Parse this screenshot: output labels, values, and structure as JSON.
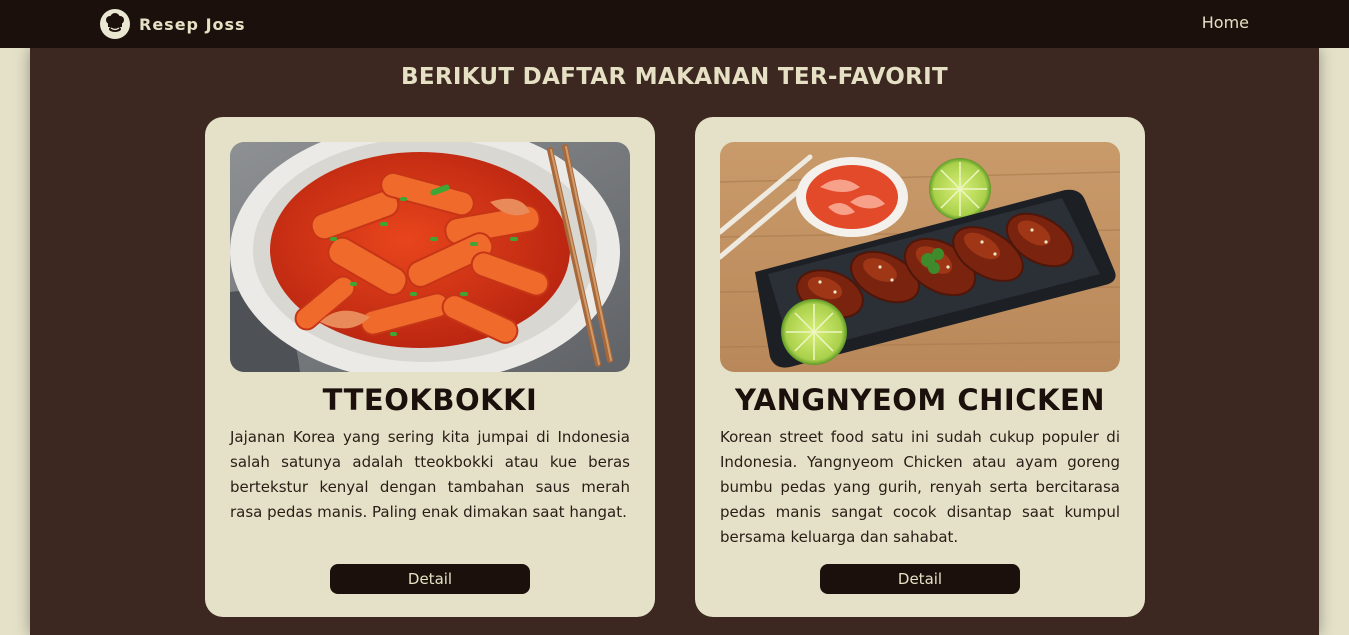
{
  "navbar": {
    "brand": "Resep Joss",
    "logo_icon": "chef-hat-icon",
    "links": [
      "Home"
    ]
  },
  "main": {
    "title": "BERIKUT DAFTAR MAKANAN TER-FAVORIT",
    "cards": [
      {
        "title": "TTEOKBOKKI",
        "image": "tteokbokki-photo",
        "description": "Jajanan Korea yang sering kita jumpai di Indonesia salah satunya adalah tteokbokki atau kue beras bertekstur kenyal dengan tambahan saus merah rasa pedas manis. Paling enak dimakan saat hangat.",
        "button": "Detail"
      },
      {
        "title": "YANGNYEOM CHICKEN",
        "image": "yangnyeom-chicken-photo",
        "description": "Korean street food satu ini sudah cukup populer di Indonesia. Yangnyeom Chicken atau ayam goreng bumbu pedas yang gurih, renyah serta bercitarasa pedas manis sangat cocok disantap saat kumpul bersama keluarga dan sahabat.",
        "button": "Detail"
      }
    ]
  },
  "colors": {
    "navbar_bg": "#1b100b",
    "main_bg": "#3c2820",
    "card_bg": "#e4e1c8",
    "page_bg": "#e4e1c8",
    "text_light": "#e6e1c4",
    "button_bg": "#1b100b"
  }
}
